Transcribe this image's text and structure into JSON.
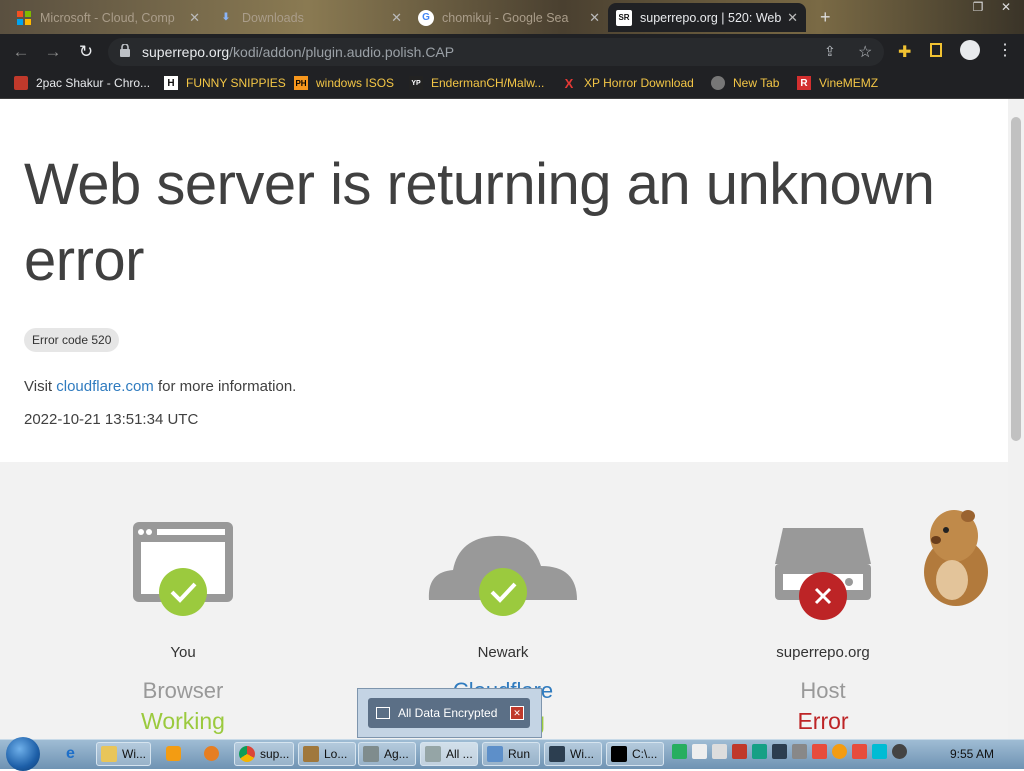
{
  "tabs": [
    {
      "label": "Microsoft - Cloud, Comp",
      "icon": "microsoft-icon",
      "active": false
    },
    {
      "label": "Downloads",
      "icon": "download-icon",
      "active": false
    },
    {
      "label": "chomikuj - Google Sea",
      "icon": "google-icon",
      "active": false
    },
    {
      "label": "superrepo.org | 520: Web",
      "icon": "superrepo-icon",
      "active": true
    }
  ],
  "tab_close": "✕",
  "new_tab": "+",
  "address": {
    "host": "superrepo.org",
    "path": "/kodi/addon/plugin.audio.polish.CAP"
  },
  "bookmarks": [
    {
      "label": "2pac Shakur - Chro...",
      "icon": "rap-icon"
    },
    {
      "label": "FUNNY SNIPPIES",
      "icon": "h-icon",
      "glyph": "H"
    },
    {
      "label": "windows ISOS",
      "icon": "ph-icon",
      "glyph": "PH"
    },
    {
      "label": "EndermanCH/Malw...",
      "icon": "yp-icon",
      "glyph": "YP"
    },
    {
      "label": "XP Horror Download",
      "icon": "x-icon",
      "glyph": "X"
    },
    {
      "label": "New Tab",
      "icon": "newtab-icon"
    },
    {
      "label": "VineMEMZ",
      "icon": "r-icon",
      "glyph": "R"
    }
  ],
  "error": {
    "heading": "Web server is returning an unknown error",
    "code_badge": "Error code 520",
    "visit_prefix": "Visit ",
    "visit_link": "cloudflare.com",
    "visit_suffix": " for more information.",
    "timestamp": "2022-10-21 13:51:34 UTC"
  },
  "status": [
    {
      "location": "You",
      "kind": "Browser",
      "state": "Working",
      "state_color": "#9bca3e",
      "ok": true
    },
    {
      "location": "Newark",
      "kind": "Cloudflare",
      "state": "Working",
      "state_color": "#9bca3e",
      "ok": true
    },
    {
      "location": "superrepo.org",
      "kind": "Host",
      "state": "Error",
      "state_color": "#bd2426",
      "ok": false
    }
  ],
  "popup": {
    "label": "All Data Encrypted"
  },
  "taskbar": {
    "items": [
      {
        "label": "Wi...",
        "icon": "folder-icon"
      },
      {
        "label": "sup...",
        "icon": "chrome-icon"
      },
      {
        "label": "Lo...",
        "icon": "app-icon"
      },
      {
        "label": "Ag...",
        "icon": "window-icon"
      },
      {
        "label": "All ...",
        "icon": "window-icon"
      },
      {
        "label": "Run",
        "icon": "run-icon"
      },
      {
        "label": "Wi...",
        "icon": "terminal-icon"
      },
      {
        "label": "C:\\...",
        "icon": "7zip-icon"
      }
    ],
    "clock": "9:55 AM"
  },
  "colors": {
    "accent_green": "#9bca3e",
    "error_red": "#bd2426",
    "link_blue": "#2f7bbf"
  }
}
